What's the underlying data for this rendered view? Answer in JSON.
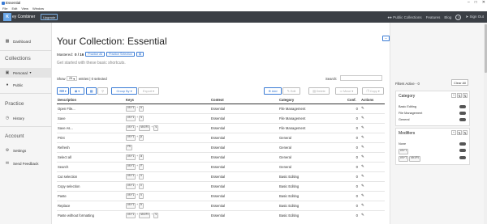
{
  "window": {
    "title": "Essential",
    "controls": [
      "–",
      "□",
      "✕"
    ]
  },
  "menu": [
    "File",
    "Edit",
    "View",
    "Window"
  ],
  "nav": {
    "logo_letter": "K",
    "logo_text": "ey Combiner",
    "upgrade": "Upgrade",
    "public_collections": "Public Collections",
    "features": "Features",
    "blog": "Blog",
    "help": "?",
    "sign_out": "Sign Out"
  },
  "sidebar": {
    "dashboard": "Dashboard",
    "collections_head": "Collections",
    "personal": "Personal",
    "public": "Public",
    "practice_head": "Practice",
    "history": "History",
    "account_head": "Account",
    "settings": "Settings",
    "send_feedback": "Send Feedback"
  },
  "main": {
    "title": "Your Collection: Essential",
    "mastered_label": "Mastered:",
    "mastered_value": "0 / 16",
    "practice_all": "Practice All",
    "practice_selection": "Practice Selection",
    "subtitle": "Get started with these basic shortcuts.",
    "collapse": "–",
    "show_label": "Show",
    "show_value": "25",
    "entries_label": "entries | 0 selected",
    "search_label": "Search:",
    "group_by": "Group By",
    "export": "Export",
    "add": "Add",
    "edit": "Edit",
    "delete": "Delete",
    "move": "Move",
    "copy": "Copy"
  },
  "table": {
    "headers": [
      "Description",
      "Keys",
      "Context",
      "Category",
      "Conf.",
      "Actions"
    ],
    "rows": [
      {
        "desc": "Open File...",
        "keys": [
          "ctrl",
          "o"
        ],
        "context": "Essential",
        "category": "File Management",
        "conf": "0"
      },
      {
        "desc": "Save",
        "keys": [
          "ctrl",
          "s"
        ],
        "context": "Essential",
        "category": "File Management",
        "conf": "0"
      },
      {
        "desc": "Save As...",
        "keys": [
          "ctrl",
          "shift",
          "s"
        ],
        "context": "Essential",
        "category": "File Management",
        "conf": "0"
      },
      {
        "desc": "Print",
        "keys": [
          "ctrl",
          "p"
        ],
        "context": "Essential",
        "category": "General",
        "conf": "0"
      },
      {
        "desc": "Refresh",
        "keys": [
          "f5"
        ],
        "context": "Essential",
        "category": "General",
        "conf": "0"
      },
      {
        "desc": "Select all",
        "keys": [
          "ctrl",
          "a"
        ],
        "context": "Essential",
        "category": "General",
        "conf": "0"
      },
      {
        "desc": "Search",
        "keys": [
          "ctrl",
          "f"
        ],
        "context": "Essential",
        "category": "General",
        "conf": "0"
      },
      {
        "desc": "Cut selection",
        "keys": [
          "ctrl",
          "x"
        ],
        "context": "Essential",
        "category": "Basic Editing",
        "conf": "0"
      },
      {
        "desc": "Copy selection",
        "keys": [
          "ctrl",
          "c"
        ],
        "context": "Essential",
        "category": "Basic Editing",
        "conf": "0"
      },
      {
        "desc": "Paste",
        "keys": [
          "ctrl",
          "v"
        ],
        "context": "Essential",
        "category": "Basic Editing",
        "conf": "0"
      },
      {
        "desc": "Replace",
        "keys": [
          "ctrl",
          "h"
        ],
        "context": "Essential",
        "category": "Basic Editing",
        "conf": "0"
      },
      {
        "desc": "Paste without formatting",
        "keys": [
          "ctrl",
          "shift",
          "v"
        ],
        "context": "Essential",
        "category": "Basic Editing",
        "conf": "0"
      }
    ]
  },
  "filters": {
    "active": "Filters Active - 0",
    "clear_all": "Clear All",
    "category_title": "Category",
    "category_items": [
      "Basic Editing",
      "File Management",
      "General"
    ],
    "modifiers_title": "Modifiers",
    "modifier_none": "None",
    "modifier_ctrl": "ctrl",
    "modifier_ctrl2": "ctrl",
    "modifier_shift": "shift"
  },
  "colors": {
    "accent": "#3a7bd5",
    "navbar": "#3b3f45",
    "sidebar": "#f5f5f5"
  }
}
